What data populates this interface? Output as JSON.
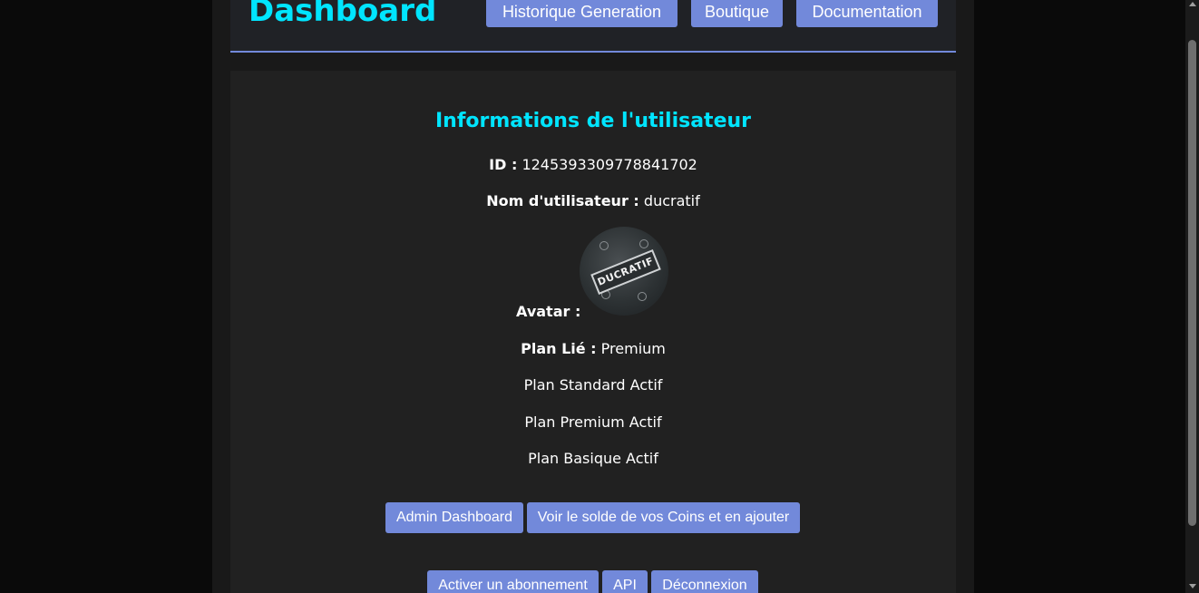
{
  "header": {
    "title": "Dashboard",
    "nav": [
      {
        "label": "Historique Generation"
      },
      {
        "label": "Boutique"
      },
      {
        "label": "Documentation"
      }
    ]
  },
  "user_info": {
    "section_title": "Informations de l'utilisateur",
    "id_label": "ID :",
    "id_value": "1245393309778841702",
    "username_label": "Nom d'utilisateur :",
    "username_value": "ducratif",
    "avatar_label": "Avatar :",
    "avatar_text": "DUCRATIF",
    "plan_label": "Plan Lié :",
    "plan_value": "Premium",
    "active_plans": [
      "Plan Standard Actif",
      "Plan Premium Actif",
      "Plan Basique Actif"
    ]
  },
  "actions": {
    "row1": [
      {
        "label": "Admin Dashboard"
      },
      {
        "label": "Voir le solde de vos Coins et en ajouter"
      }
    ],
    "row2": [
      {
        "label": "Activer un abonnement"
      },
      {
        "label": "API"
      },
      {
        "label": "Déconnexion"
      }
    ]
  },
  "colors": {
    "accent": "#00e5ff",
    "button": "#7289da",
    "panel": "#212121",
    "background": "#0a0a0a"
  }
}
